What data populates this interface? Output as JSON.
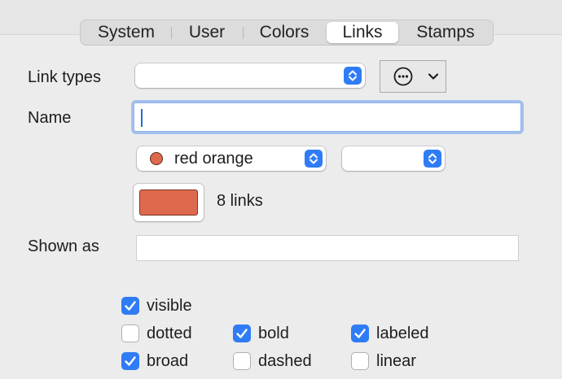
{
  "tabs": [
    {
      "label": "System",
      "selected": false
    },
    {
      "label": "User",
      "selected": false
    },
    {
      "label": "Colors",
      "selected": false
    },
    {
      "label": "Links",
      "selected": true
    },
    {
      "label": "Stamps",
      "selected": false
    }
  ],
  "form": {
    "link_types_label": "Link types",
    "link_types_value": "",
    "name_label": "Name",
    "name_value": "",
    "color_popup_value": "red orange",
    "secondary_popup_value": "",
    "link_count_text": "8 links",
    "shown_as_label": "Shown as",
    "shown_as_value": ""
  },
  "colors": {
    "link_color": "#de6a4e",
    "accent": "#2f7cf6"
  },
  "icons": {
    "action_menu": "ellipsis-circle-icon",
    "dropdown": "chevron-down-icon",
    "stepper": "up-down-chevrons-icon"
  },
  "checkboxes": [
    {
      "label": "visible",
      "checked": true
    },
    {
      "label": "dotted",
      "checked": false
    },
    {
      "label": "bold",
      "checked": true
    },
    {
      "label": "labeled",
      "checked": true
    },
    {
      "label": "broad",
      "checked": true
    },
    {
      "label": "dashed",
      "checked": false
    },
    {
      "label": "linear",
      "checked": false
    }
  ]
}
